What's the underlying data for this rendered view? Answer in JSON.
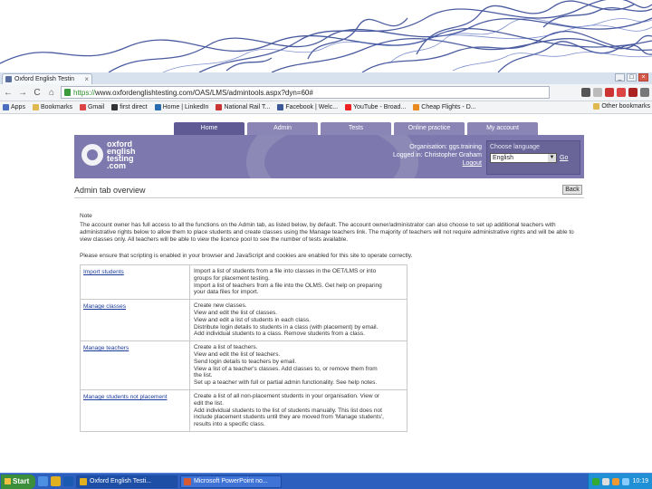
{
  "browser": {
    "tab_title": "Oxford English Testin",
    "tab_close": "×",
    "url_scheme": "https://",
    "url_rest": "www.oxfordenglishtesting.com/OAS/LMS/admintools.aspx?dyn=60#",
    "back": "←",
    "forward": "→",
    "reload": "C",
    "home": "⌂",
    "bookmarks": [
      "Apps",
      "Bookmarks",
      "Gmail",
      "first direct",
      "Home | LinkedIn",
      "National Rail T...",
      "Facebook | Welc...",
      "YouTube - Broad...",
      "Cheap Flights - D..."
    ],
    "other_bookmarks": "Other bookmarks",
    "colors": {
      "secure": "#2a8a2a",
      "tab_bg": "#d8e2ee"
    }
  },
  "site": {
    "tabs": [
      "Home",
      "Admin",
      "Tests",
      "Online practice",
      "My account"
    ],
    "logo": [
      "oxford",
      "english",
      "testing",
      ".com"
    ],
    "org_line": "Organisation: ggs.training",
    "logged_line": "Logged in: Christopher Graham",
    "logout": "Logout",
    "lang_label": "Choose language",
    "lang_value": "English",
    "lang_go": "Go",
    "colors": {
      "header": "#7d78ad",
      "tab": "#8a85b5",
      "tab_active": "#5f5a93"
    }
  },
  "content": {
    "page_title": "Admin tab overview",
    "back_label": "Back",
    "note_heading": "Note",
    "note_text": "The account owner has full access to all the functions on the Admin tab, as listed below, by default. The account owner/administrator can also choose to set up additional teachers with administrative rights below to allow them to place students and create classes using the Manage teachers link. The majority of teachers will not require administrative rights and will be able to view classes only. All teachers will be able to view the licence pool to see the number of tests available.",
    "instructions": "Please ensure that scripting is enabled in your browser and JavaScript and cookies are enabled for this site to operate correctly.",
    "tools": [
      {
        "link": "Import students",
        "desc": [
          "Import a list of students from a file into classes in the OET/LMS or into",
          "groups for placement testing.",
          "Import a list of teachers from a file into the OLMS. Get help on preparing",
          "your data files for import."
        ]
      },
      {
        "link": "Manage classes",
        "desc": [
          "Create new classes.",
          "View and edit the list of classes.",
          "View and edit a list of students in each class.",
          "Distribute login details to students in a class (with placement) by email.",
          "Add individual students to a class. Remove students from a class."
        ]
      },
      {
        "link": "Manage teachers",
        "desc": [
          "Create a list of teachers.",
          "View and edit the list of teachers.",
          "Send login details to teachers by email.",
          "View a list of a teacher's classes. Add classes to, or remove them from",
          "the list.",
          "Set up a teacher with full or partial admin functionality. See help notes."
        ]
      },
      {
        "link": "Manage students not placement",
        "desc": [
          "Create a list of all non-placement students in your organisation. View or",
          "edit the list.",
          "Add individual students to the list of students manually. This list does not",
          "include placement students until they are moved from 'Manage students',",
          "results into a specific class."
        ]
      }
    ]
  },
  "taskbar": {
    "start": "Start",
    "items": [
      {
        "label": "Oxford English Testi...",
        "active": true
      },
      {
        "label": "Microsoft PowerPoint no...",
        "active": false
      }
    ],
    "clock": "10:19"
  }
}
